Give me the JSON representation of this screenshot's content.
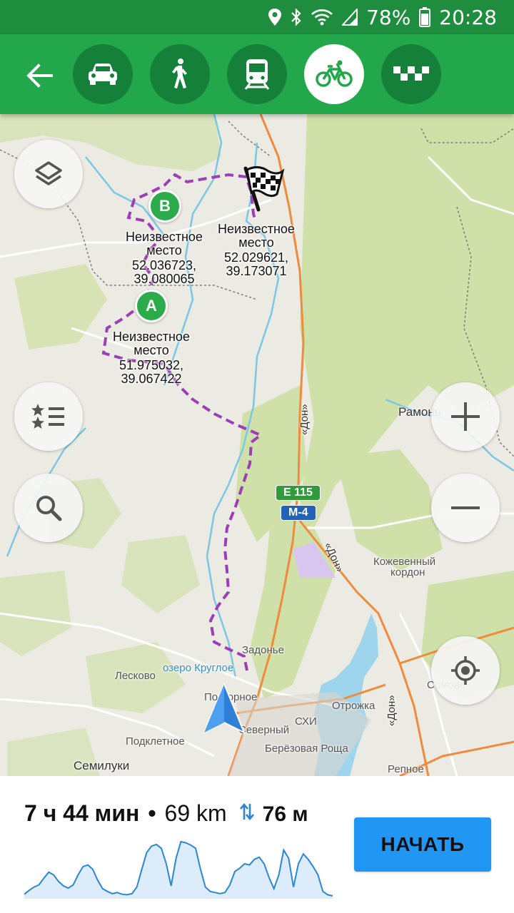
{
  "status_bar": {
    "icons": [
      "location-icon",
      "bluetooth-icon",
      "wifi-icon",
      "signal-icon",
      "battery-icon"
    ],
    "battery": "78%",
    "time": "20:28"
  },
  "toolbar": {
    "back_icon": "arrow-left-icon",
    "modes": [
      {
        "name": "car",
        "icon": "car-icon"
      },
      {
        "name": "walk",
        "icon": "pedestrian-icon"
      },
      {
        "name": "transit",
        "icon": "train-icon"
      },
      {
        "name": "bike",
        "icon": "bicycle-icon",
        "active": true
      },
      {
        "name": "taxi",
        "icon": "taxi-icon"
      }
    ]
  },
  "map": {
    "points": {
      "a": {
        "letter": "A",
        "name_line1": "Неизвестное",
        "name_line2": "место",
        "coord_line1": "51.975032,",
        "coord_line2": "39.067422"
      },
      "b": {
        "letter": "B",
        "name_line1": "Неизвестное",
        "name_line2": "место",
        "coord_line1": "52.036723,",
        "coord_line2": "39.080065"
      },
      "finish": {
        "name_line1": "Неизвестное",
        "name_line2": "место",
        "coord_line1": "52.029621,",
        "coord_line2": "39.173071"
      }
    },
    "place_labels": {
      "ramon": "Рамонь",
      "kozhevenny1": "Кожевенный",
      "kozhevenny2": "кордон",
      "zadonye": "Задонье",
      "lesovo": "Лесково",
      "lake": "озеро Круглое",
      "podgornoe": "Подгорное",
      "skhi": "СХИ",
      "otrozhka": "Отрожка",
      "severny": "Северный",
      "podkletnoe": "Подклетное",
      "berezovaya": "Берёзовая Роща",
      "semiluki": "Семилуки",
      "repnoe": "Репное",
      "somovo": "Сомово"
    },
    "road_labels": {
      "don1": "«Дон»",
      "don2": "«Дон»",
      "don3": "«Дон»",
      "e115": "E 115",
      "m4": "M-4"
    },
    "colors": {
      "route": "#9b3fb5",
      "forest": "#cfe0a6",
      "water": "#9fd5ec",
      "highway": "#f08a3c",
      "brand_green": "#22a74a"
    },
    "buttons": [
      "layers-icon",
      "bookmarks-icon",
      "search-icon",
      "zoom-in-icon",
      "zoom-out-icon",
      "my-location-icon"
    ]
  },
  "route": {
    "duration": "7 ч 44 мин",
    "separator": "•",
    "distance": "69 km",
    "elevation": "76 м",
    "start_label": "НАЧАТЬ",
    "elevation_profile": [
      5,
      12,
      18,
      22,
      34,
      45,
      40,
      28,
      20,
      16,
      22,
      40,
      55,
      58,
      50,
      30,
      15,
      10,
      6,
      8,
      5,
      4,
      6,
      18,
      50,
      80,
      92,
      95,
      88,
      60,
      20,
      70,
      100,
      98,
      94,
      88,
      50,
      18,
      10,
      8,
      6,
      8,
      22,
      46,
      52,
      60,
      58,
      68,
      72,
      60,
      35,
      15,
      40,
      85,
      70,
      18,
      60,
      78,
      68,
      55,
      40,
      10,
      4,
      2
    ]
  }
}
